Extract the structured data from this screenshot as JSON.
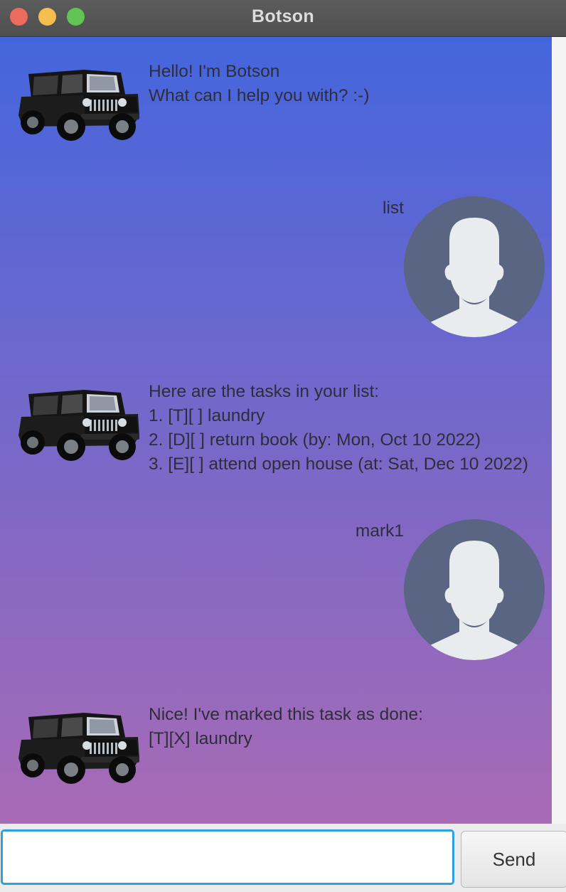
{
  "window": {
    "title": "Botson"
  },
  "messages": [
    {
      "sender": "bot",
      "lines": "Hello! I'm Botson\nWhat can I help you with? :-)",
      "avatar": "jeep-icon"
    },
    {
      "sender": "user",
      "lines": "list",
      "avatar": "user-silhouette-icon"
    },
    {
      "sender": "bot",
      "lines": "Here are the tasks in your list:\n1. [T][ ] laundry\n2. [D][ ] return book (by: Mon, Oct 10 2022)\n3. [E][ ] attend open house (at: Sat, Dec 10 2022)",
      "avatar": "jeep-icon"
    },
    {
      "sender": "user",
      "lines": "mark1",
      "avatar": "user-silhouette-icon"
    },
    {
      "sender": "bot",
      "lines": "Nice! I've marked this task as done:\n[T][X] laundry",
      "avatar": "jeep-icon"
    }
  ],
  "input": {
    "value": "",
    "placeholder": ""
  },
  "send_label": "Send",
  "colors": {
    "gradient_top": "#4466dd",
    "gradient_bottom": "#a86ab5",
    "input_focus": "#2f9fe0",
    "avatar_bg": "#5a6483"
  }
}
